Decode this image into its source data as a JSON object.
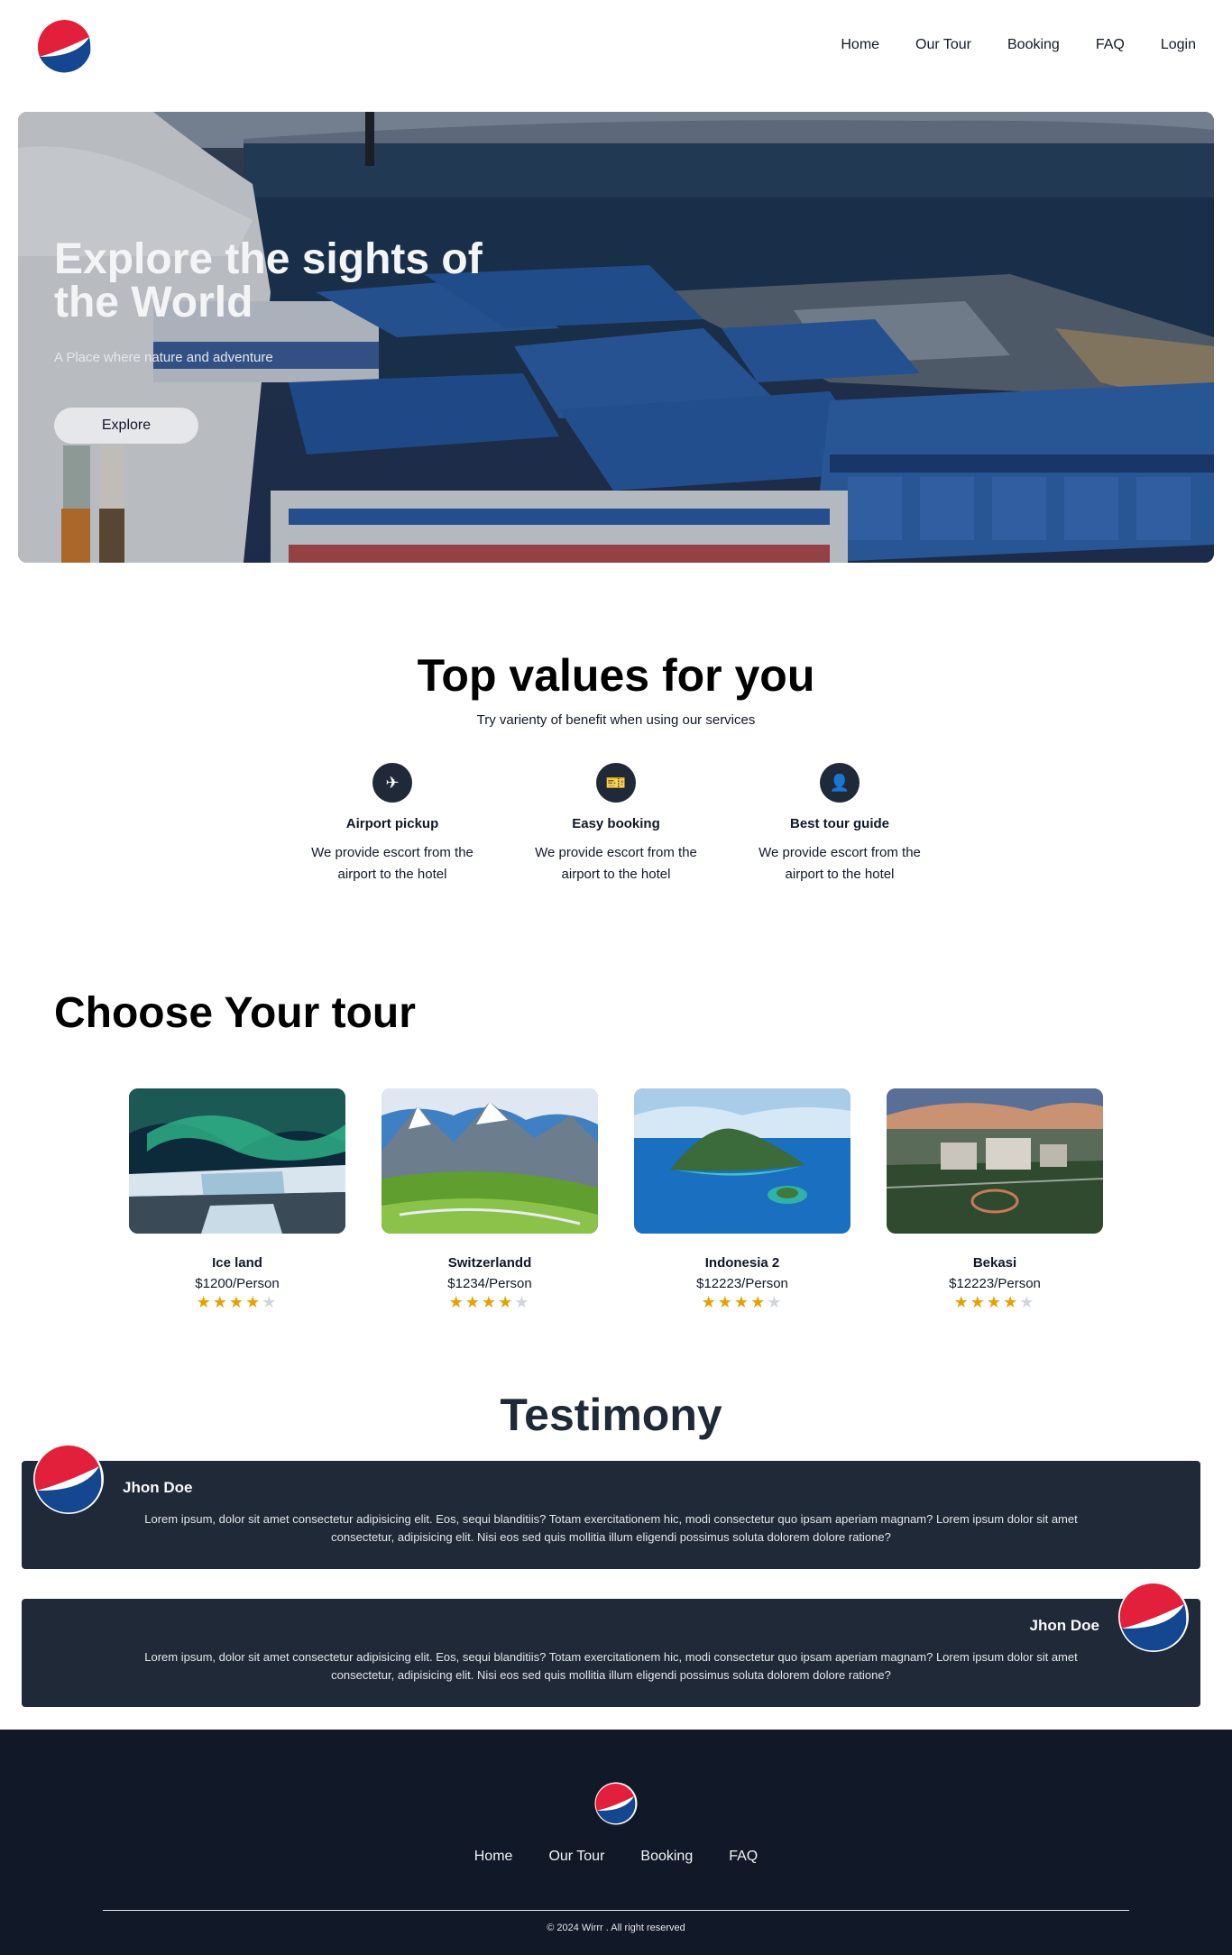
{
  "header": {
    "nav": [
      "Home",
      "Our Tour",
      "Booking",
      "FAQ",
      "Login"
    ]
  },
  "hero": {
    "title": "Explore the sights of the World",
    "subtitle": "A Place where nature and adventure",
    "button_label": "Explore"
  },
  "values": {
    "title": "Top values for you",
    "subtitle": "Try varienty of benefit when using our services",
    "features": [
      {
        "icon": "airplane-icon",
        "glyph": "✈",
        "title": "Airport pickup",
        "description": "We provide escort from the airport to the hotel"
      },
      {
        "icon": "ticket-icon",
        "glyph": "🎫",
        "title": "Easy booking",
        "description": "We provide escort from the airport to the hotel"
      },
      {
        "icon": "guide-icon",
        "glyph": "👤",
        "title": "Best tour guide",
        "description": "We provide escort from the airport to the hotel"
      }
    ]
  },
  "tours": {
    "title": "Choose Your tour",
    "items": [
      {
        "name": "Ice land",
        "price": "$1200/Person",
        "rating": 4
      },
      {
        "name": "Switzerlandd",
        "price": "$1234/Person",
        "rating": 4
      },
      {
        "name": "Indonesia 2",
        "price": "$12223/Person",
        "rating": 4
      },
      {
        "name": "Bekasi",
        "price": "$12223/Person",
        "rating": 4
      }
    ]
  },
  "testimony": {
    "title": "Testimony",
    "items": [
      {
        "name": "Jhon Doe",
        "text": "Lorem ipsum, dolor sit amet consectetur adipisicing elit. Eos, sequi blanditiis? Totam exercitationem hic, modi consectetur quo ipsam aperiam magnam? Lorem ipsum dolor sit amet consectetur, adipisicing elit. Nisi eos sed quis mollitia illum eligendi possimus soluta dolorem dolore ratione?"
      },
      {
        "name": "Jhon Doe",
        "text": "Lorem ipsum, dolor sit amet consectetur adipisicing elit. Eos, sequi blanditiis? Totam exercitationem hic, modi consectetur quo ipsam aperiam magnam? Lorem ipsum dolor sit amet consectetur, adipisicing elit. Nisi eos sed quis mollitia illum eligendi possimus soluta dolorem dolore ratione?"
      }
    ]
  },
  "footer": {
    "nav": [
      "Home",
      "Our Tour",
      "Booking",
      "FAQ"
    ],
    "copyright": "© 2024 Wirrr . All right reserved"
  },
  "colors": {
    "brand_red": "#e2203b",
    "brand_blue": "#14478f",
    "dark": "#1f2937",
    "footer_bg": "#111827",
    "star": "#e6a100"
  }
}
